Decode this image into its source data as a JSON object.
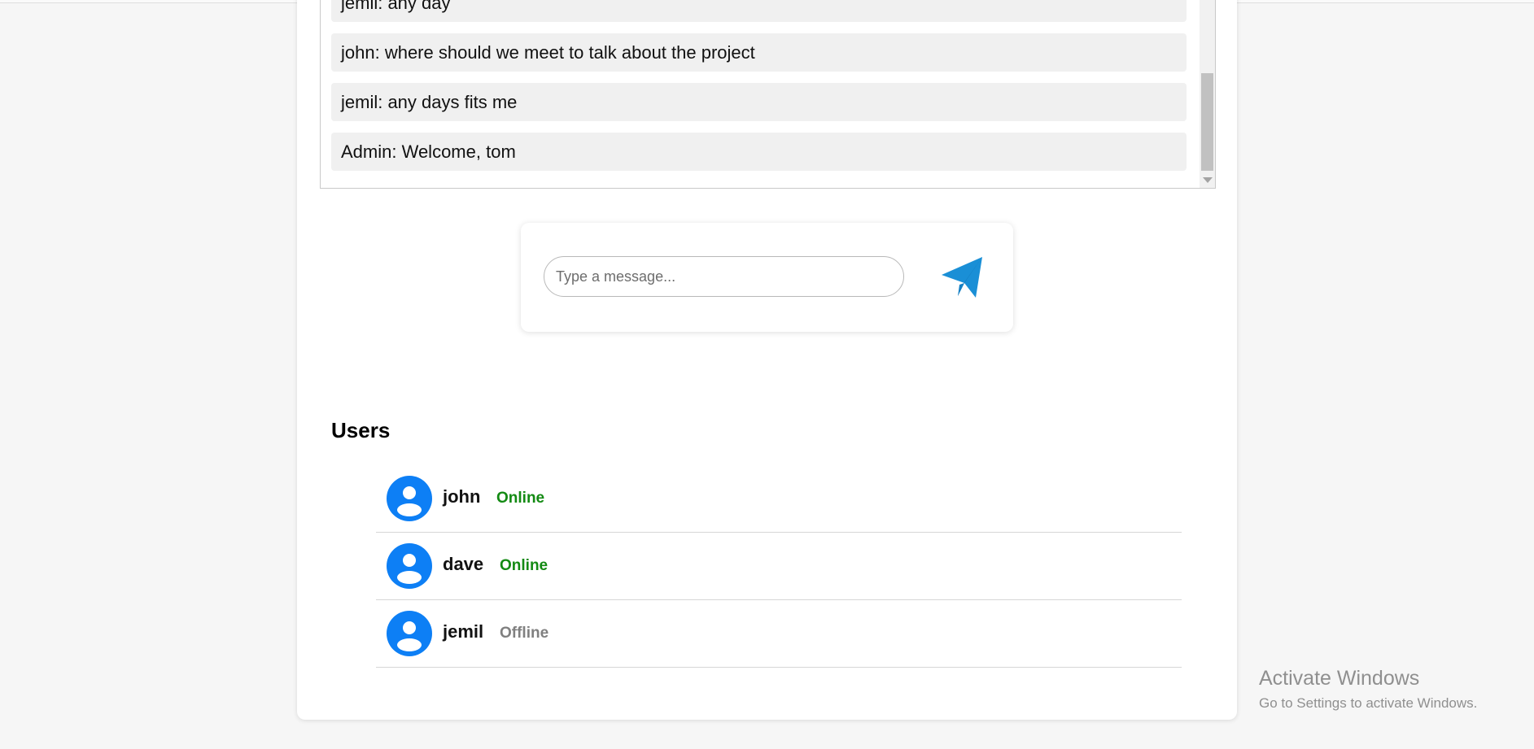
{
  "chat": {
    "messages": [
      {
        "text": "jemil: any day"
      },
      {
        "text": "john: where should we meet to talk about the project"
      },
      {
        "text": "jemil: any days fits me"
      },
      {
        "text": "Admin: Welcome, tom"
      }
    ]
  },
  "composer": {
    "placeholder": "Type a message...",
    "value": "",
    "send_icon": "paper-plane-icon",
    "send_color": "#1a8fd6"
  },
  "users": {
    "title": "Users",
    "list": [
      {
        "name": "john",
        "status": "Online"
      },
      {
        "name": "dave",
        "status": "Online"
      },
      {
        "name": "jemil",
        "status": "Offline"
      }
    ],
    "colors": {
      "online": "#138a13",
      "offline": "#808080",
      "avatar": "#0d7ff5"
    }
  },
  "watermark": {
    "title": "Activate Windows",
    "subtitle": "Go to Settings to activate Windows."
  }
}
